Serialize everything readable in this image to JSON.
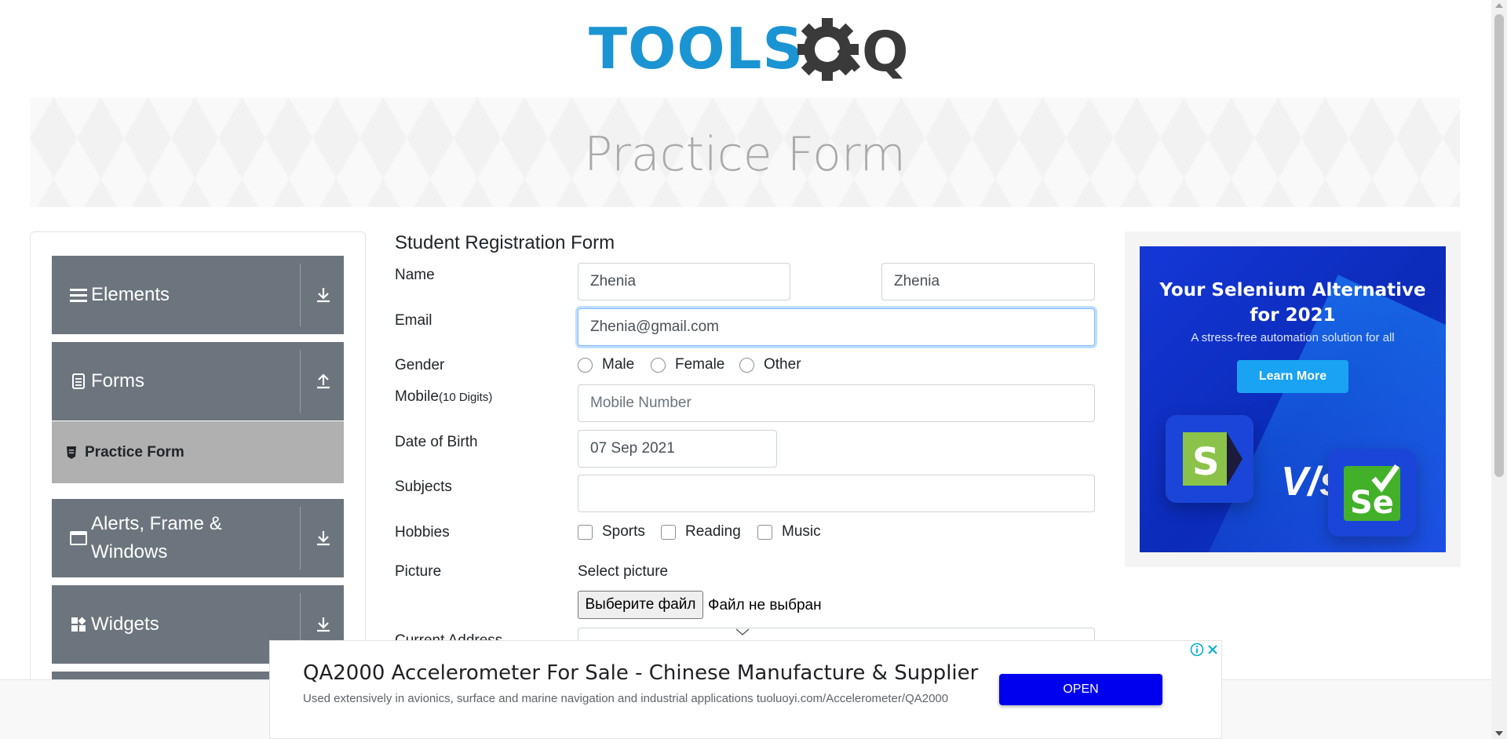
{
  "logo": {
    "text": "TOOLS",
    "qa_text": "QA"
  },
  "banner": {
    "title": "Practice Form"
  },
  "sidebar": {
    "groups": [
      {
        "label": "Elements",
        "icon": "hamburger-icon",
        "toggle": "download-icon"
      },
      {
        "label": "Forms",
        "icon": "document-icon",
        "toggle": "upload-icon"
      },
      {
        "label": "Alerts, Frame & Windows",
        "icon": "window-icon",
        "toggle": "download-icon"
      },
      {
        "label": "Widgets",
        "icon": "widgets-icon",
        "toggle": "download-icon"
      }
    ],
    "active_item": {
      "label": "Practice Form",
      "icon": "shield-icon"
    }
  },
  "form": {
    "title": "Student Registration Form",
    "name_label": "Name",
    "first_name": "Zhenia",
    "last_name": "Zhenia",
    "email_label": "Email",
    "email": "Zhenia@gmail.com",
    "gender_label": "Gender",
    "gender_options": [
      "Male",
      "Female",
      "Other"
    ],
    "mobile_label": "Mobile",
    "mobile_hint": "(10 Digits)",
    "mobile_placeholder": "Mobile Number",
    "dob_label": "Date of Birth",
    "dob": "07 Sep 2021",
    "subjects_label": "Subjects",
    "hobbies_label": "Hobbies",
    "hobbies": [
      "Sports",
      "Reading",
      "Music"
    ],
    "picture_label": "Picture",
    "select_picture": "Select picture",
    "file_button": "Выберите файл",
    "file_status": "Файл не выбран",
    "address_label": "Current Address"
  },
  "side_ad": {
    "title_line1": "Your Selenium Alternative",
    "title_line2": "for 2021",
    "subtitle": "A stress-free automation solution for all",
    "button": "Learn More",
    "vs": "V/s",
    "logo_left": "S",
    "logo_right": "Se",
    "colors": {
      "background": "#1537d6",
      "button": "#1aa3f2"
    }
  },
  "bottom_ad": {
    "title": "QA2000 Accelerometer For Sale - Chinese Manufacture & Supplier",
    "description": "Used extensively in avionics, surface and marine navigation and industrial applications tuoluoyi.com/Accelerometer/QA2000",
    "button": "OPEN"
  },
  "colors": {
    "sidebar_group": "#6c757d",
    "sidebar_active": "#b0b0b0",
    "logo_blue": "#1b94d3",
    "logo_dark": "#3a3a3a",
    "focus_border": "#80bdff",
    "ad_open_button": "#0000ee"
  }
}
